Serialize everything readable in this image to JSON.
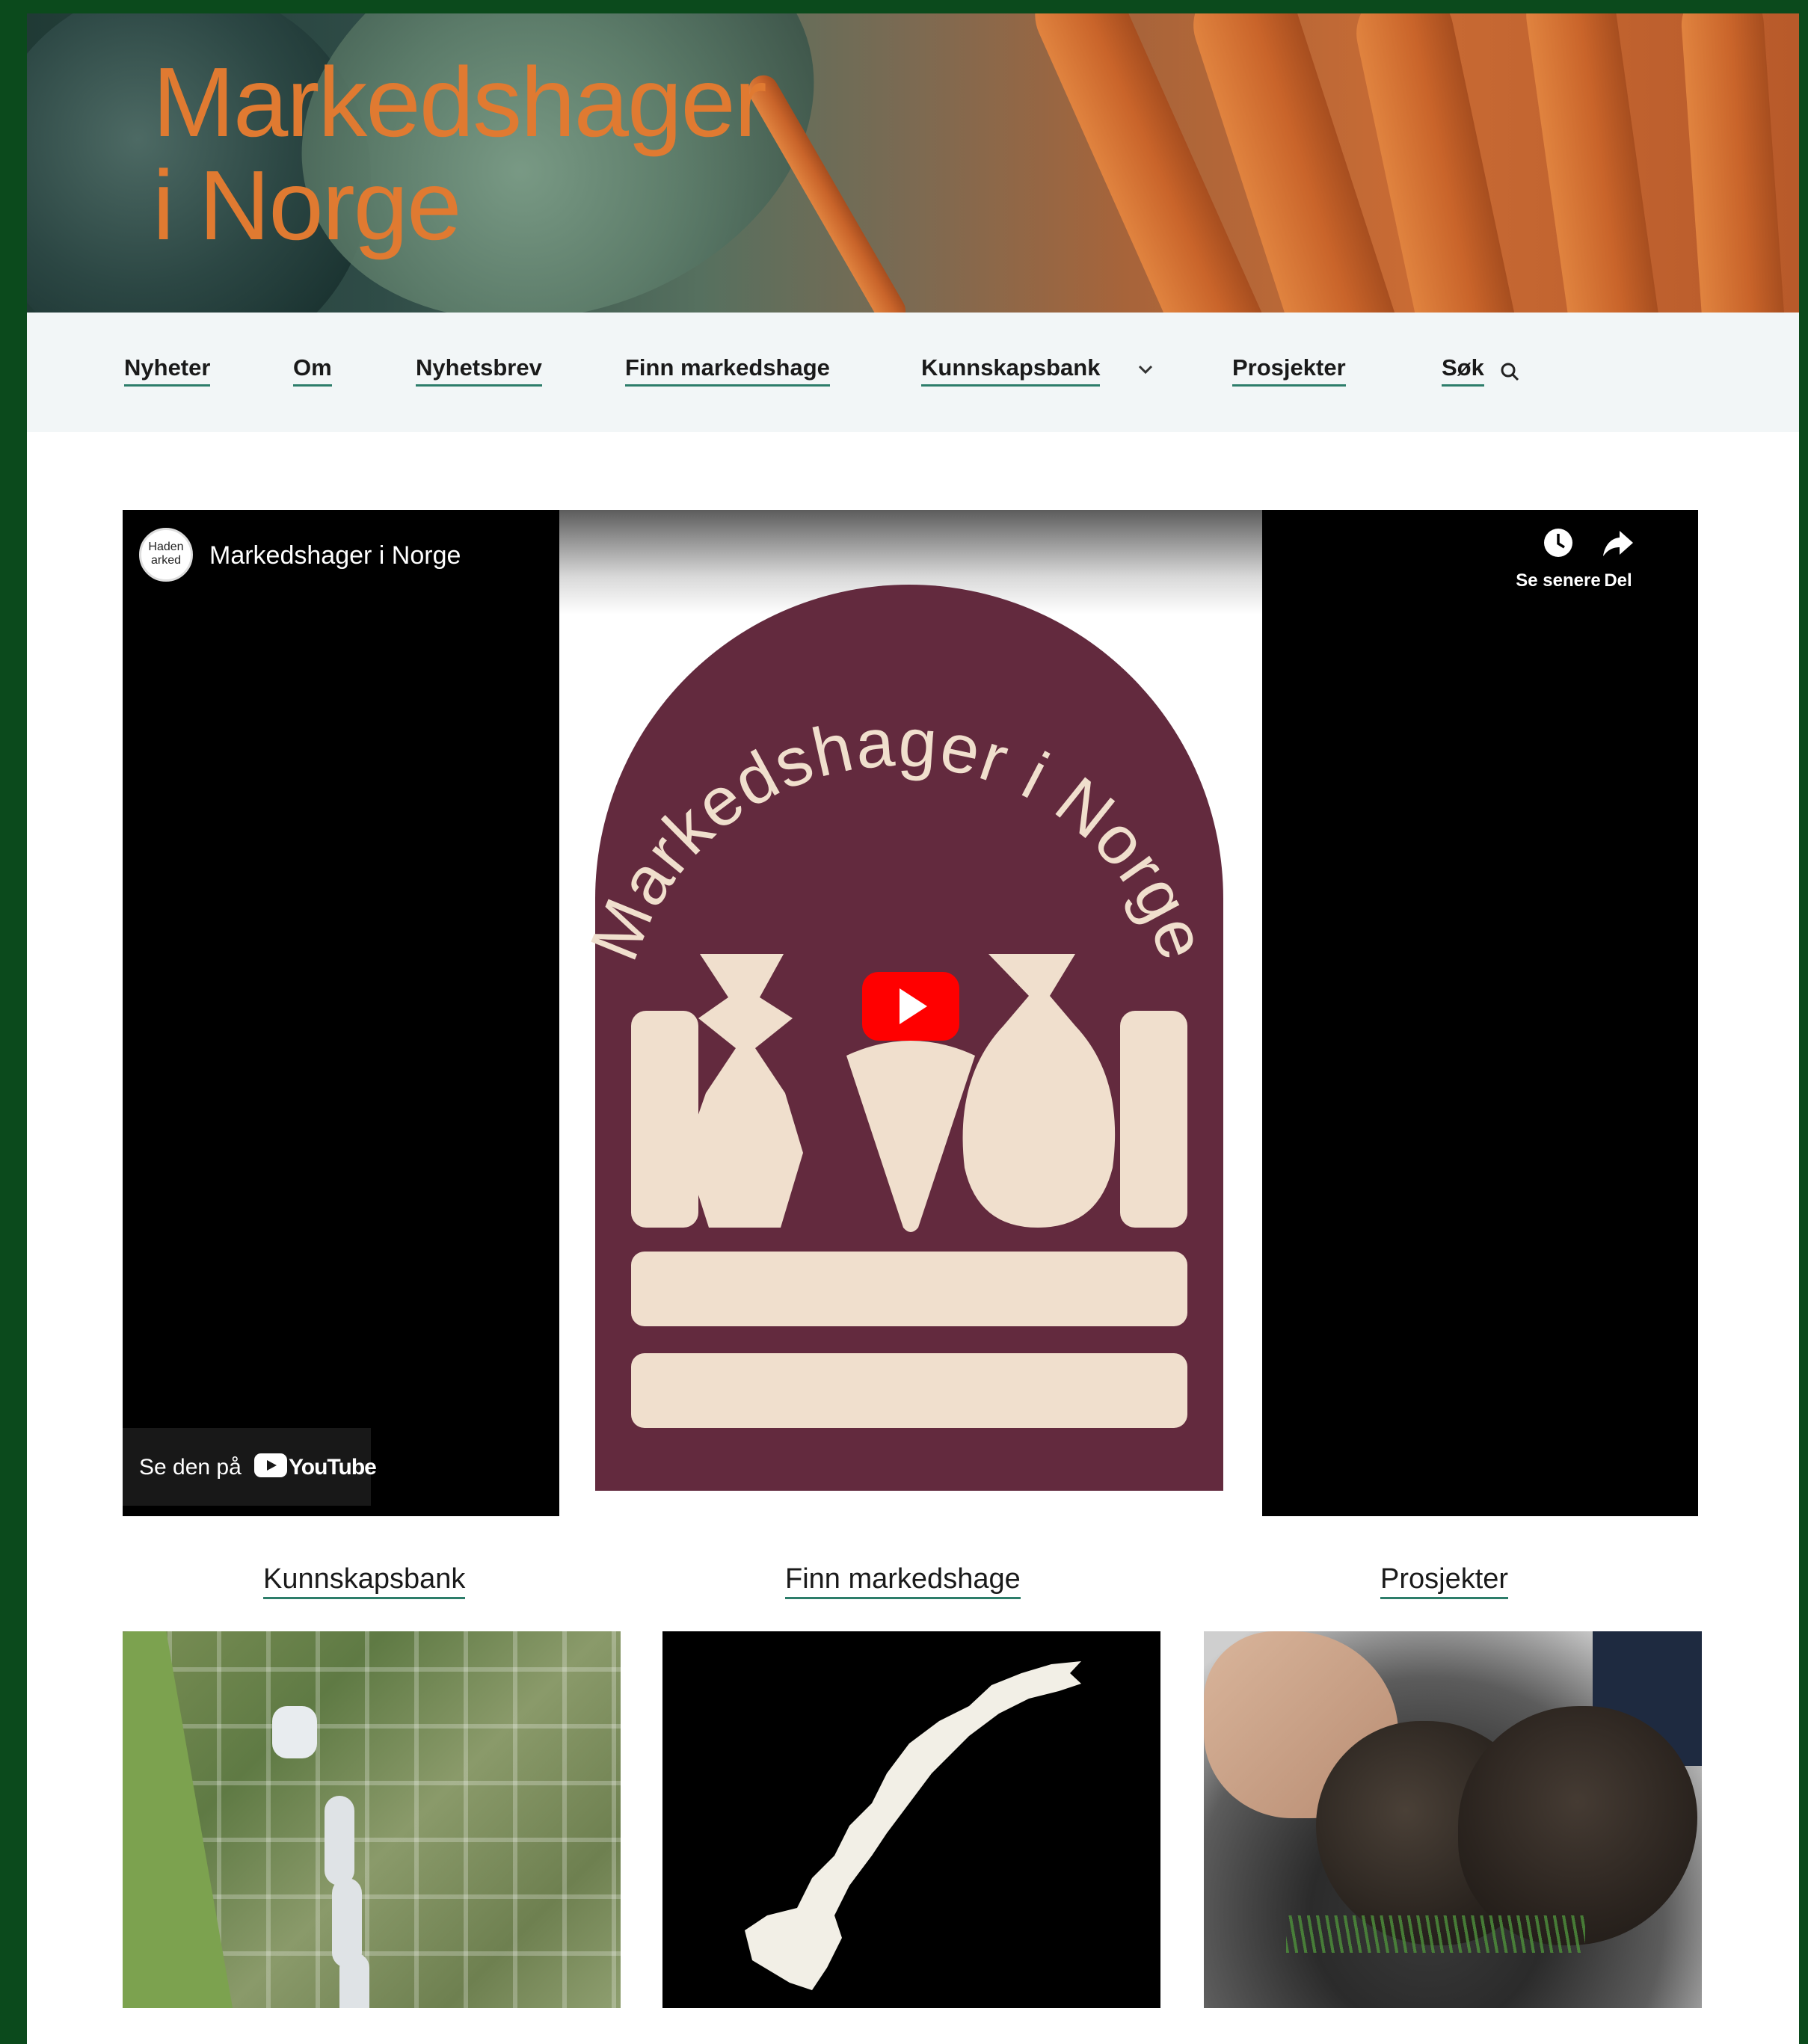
{
  "hero": {
    "title_line1": "Markedshager",
    "title_line2": "i Norge"
  },
  "nav": {
    "items": [
      {
        "label": "Nyheter"
      },
      {
        "label": "Om"
      },
      {
        "label": "Nyhetsbrev"
      },
      {
        "label": "Finn markedshage"
      },
      {
        "label": "Kunnskapsbank"
      },
      {
        "label": "Prosjekter"
      },
      {
        "label": "Søk"
      }
    ]
  },
  "video": {
    "channel_title": "Markedshager i Norge",
    "avatar_text": "Haden arked",
    "logo_text": "Markedshager i Norge",
    "actions": {
      "watch_later": "Se senere",
      "share": "Del"
    },
    "watch_on_label": "Se den på",
    "youtube_word": "YouTube"
  },
  "cards": [
    {
      "title": "Kunnskapsbank"
    },
    {
      "title": "Finn markedshage"
    },
    {
      "title": "Prosjekter"
    }
  ],
  "colors": {
    "page_border": "#0b4a1c",
    "title_orange": "#e07a31",
    "nav_underline": "#2d7d6a",
    "logo_maroon": "#632a3e",
    "logo_cream": "#f0dfcd",
    "youtube_red": "#ff0000"
  },
  "icons": [
    "search-icon",
    "chevron-down-icon",
    "clock-icon",
    "share-icon",
    "play-icon",
    "youtube-icon"
  ]
}
